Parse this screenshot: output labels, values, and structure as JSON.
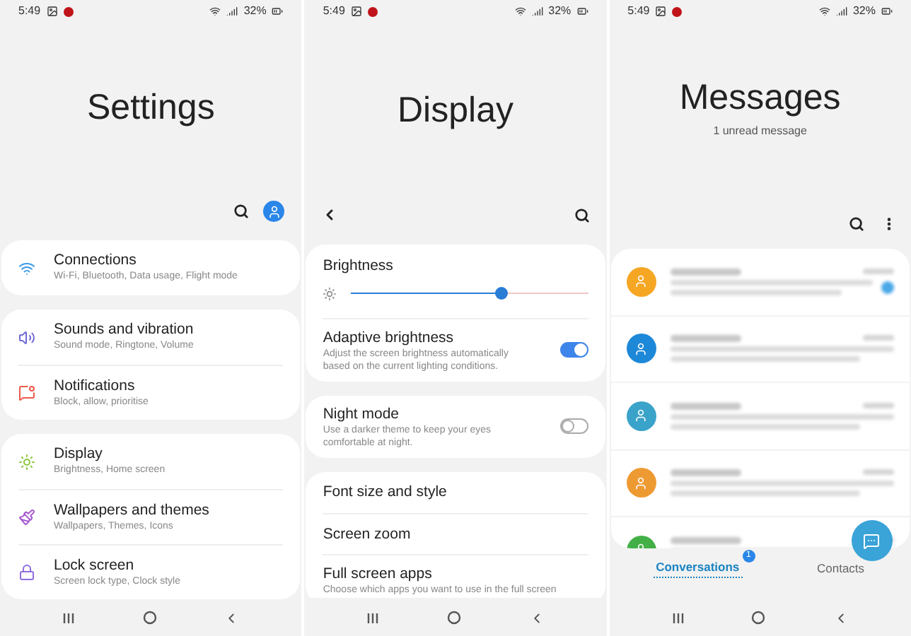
{
  "screens": [
    {
      "kind": "settings",
      "status_bar": {
        "time": "5:49",
        "battery": "32%"
      },
      "title": "Settings",
      "groups": [
        [
          {
            "title": "Connections",
            "subtitle": "Wi-Fi, Bluetooth, Data usage, Flight mode"
          }
        ],
        [
          {
            "title": "Sounds and vibration",
            "subtitle": "Sound mode, Ringtone, Volume"
          },
          {
            "title": "Notifications",
            "subtitle": "Block, allow, prioritise"
          }
        ],
        [
          {
            "title": "Display",
            "subtitle": "Brightness, Home screen"
          },
          {
            "title": "Wallpapers and themes",
            "subtitle": "Wallpapers, Themes, Icons"
          },
          {
            "title": "Lock screen",
            "subtitle": "Screen lock type, Clock style"
          }
        ]
      ]
    },
    {
      "kind": "display",
      "status_bar": {
        "time": "5:49",
        "battery": "32%"
      },
      "title": "Display",
      "brightness": {
        "label": "Brightness",
        "level": 0.63
      },
      "cards": [
        [
          {
            "kind": "toggle",
            "title": "Adaptive brightness",
            "subtitle": "Adjust the screen brightness automatically based on the current lighting conditions.",
            "on": true
          }
        ],
        [
          {
            "kind": "toggle",
            "title": "Night mode",
            "subtitle": "Use a darker theme to keep your eyes comfortable at night.",
            "on": false
          }
        ],
        [
          {
            "kind": "link",
            "title": "Font size and style"
          },
          {
            "kind": "link",
            "title": "Screen zoom"
          },
          {
            "kind": "link",
            "title": "Full screen apps",
            "subtitle": "Choose which apps you want to use in the full screen"
          }
        ]
      ]
    },
    {
      "kind": "messages",
      "status_bar": {
        "time": "5:49",
        "battery": "32%"
      },
      "title": "Messages",
      "subtitle": "1 unread message",
      "conversations": [
        {
          "color": "#f5a623",
          "unread": true
        },
        {
          "color": "#1e88d8",
          "unread": false
        },
        {
          "color": "#3aa3c9",
          "unread": false
        },
        {
          "color": "#ee9a33",
          "unread": false
        },
        {
          "color": "#43b047",
          "unread": false
        }
      ],
      "tabs": [
        {
          "label": "Conversations",
          "badge": "1",
          "selected": true
        },
        {
          "label": "Contacts",
          "selected": false
        }
      ]
    }
  ]
}
